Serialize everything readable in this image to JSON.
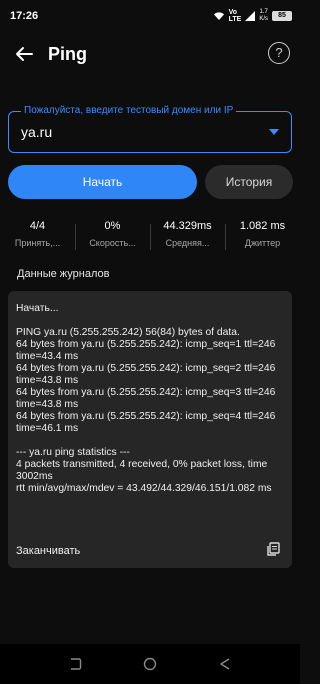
{
  "status_bar": {
    "time": "17:26",
    "network": "Vo\nLTE",
    "speed": "1.7\nK/s",
    "battery": "85"
  },
  "app_bar": {
    "title": "Ping",
    "back_icon": "arrow-left-icon",
    "help_icon": "help-circle-icon"
  },
  "host_field": {
    "label": "Пожалуйста, введите тестовый домен или IP",
    "value": "ya.ru"
  },
  "buttons": {
    "start": "Начать",
    "history": "История"
  },
  "stats": [
    {
      "value": "4/4",
      "label": "Принять,..."
    },
    {
      "value": "0%",
      "label": "Скорость..."
    },
    {
      "value": "44.329ms",
      "label": "Средняя..."
    },
    {
      "value": "1.082 ms",
      "label": "Джиттер"
    }
  ],
  "log": {
    "title": "Данные журналов",
    "text": "Начать...\n\nPING ya.ru (5.255.255.242) 56(84) bytes of data.\n64 bytes from ya.ru (5.255.255.242): icmp_seq=1 ttl=246 time=43.4 ms\n64 bytes from ya.ru (5.255.255.242): icmp_seq=2 ttl=246 time=43.8 ms\n64 bytes from ya.ru (5.255.255.242): icmp_seq=3 ttl=246 time=43.8 ms\n64 bytes from ya.ru (5.255.255.242): icmp_seq=4 ttl=246 time=46.1 ms\n\n--- ya.ru ping statistics ---\n4 packets transmitted, 4 received, 0% packet loss, time 3002ms\nrtt min/avg/max/mdev = 43.492/44.329/46.151/1.082 ms",
    "finish": "Заканчивать"
  },
  "colors": {
    "accent": "#2f86f7",
    "background": "#0d0d0d",
    "card": "#262626"
  }
}
